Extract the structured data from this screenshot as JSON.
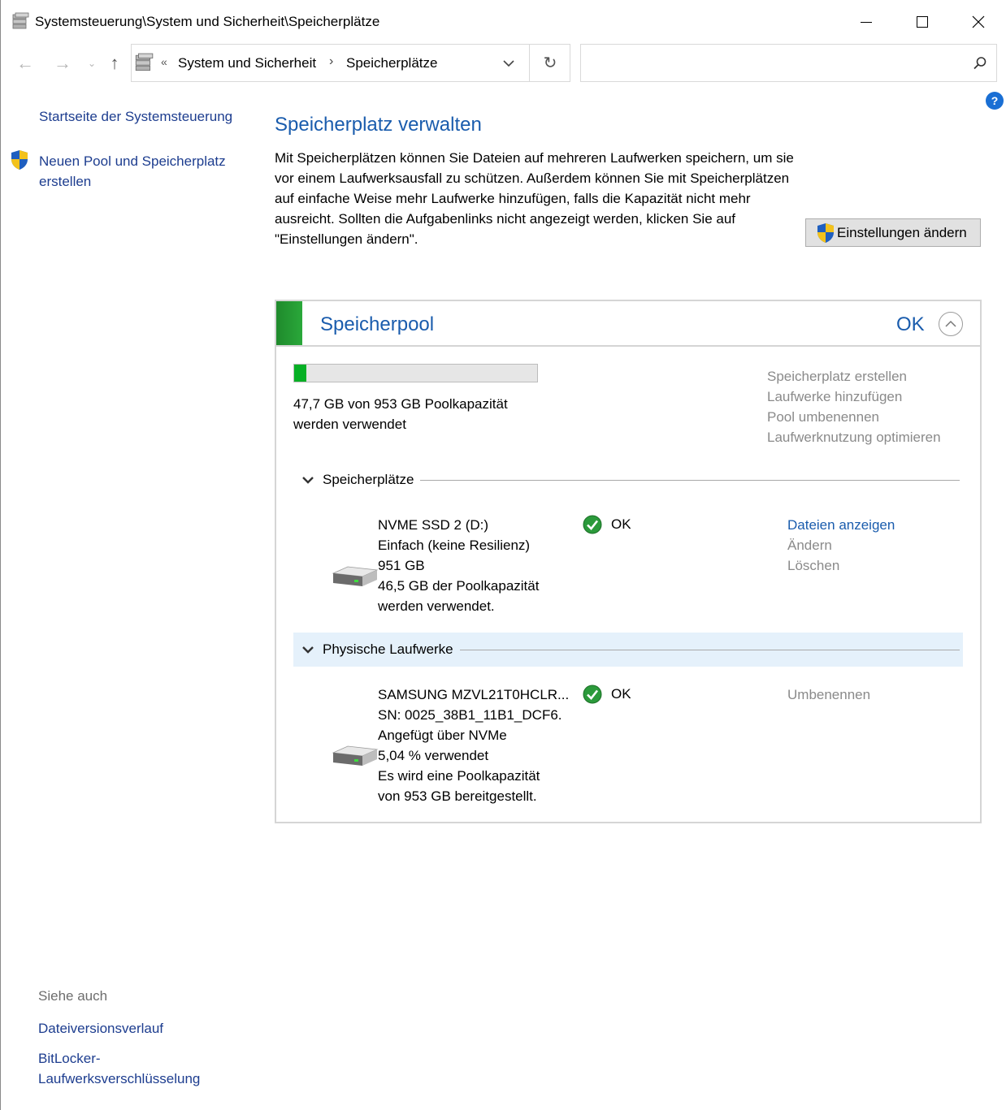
{
  "window": {
    "title": "Systemsteuerung\\System und Sicherheit\\Speicherplätze"
  },
  "navigation": {
    "back_glyph": "←",
    "forward_glyph": "→",
    "recent_glyph": "⌄",
    "up_glyph": "↑",
    "breadcrumb_overflow": "«",
    "breadcrumbs": [
      "System und Sicherheit",
      "Speicherplätze"
    ],
    "breadcrumb_separator": "›",
    "refresh_glyph": "↻",
    "search_placeholder": ""
  },
  "help": {
    "label": "?"
  },
  "left_pane": {
    "home_link": "Startseite der Systemsteuerung",
    "new_pool_link": "Neuen Pool und Speicherplatz erstellen",
    "see_also_label": "Siehe auch",
    "see_also_links": [
      "Dateiversionsverlauf",
      "BitLocker-Laufwerksverschlüsselung"
    ]
  },
  "main": {
    "title": "Speicherplatz verwalten",
    "intro": "Mit Speicherplätzen können Sie Dateien auf mehreren Laufwerken speichern, um sie vor einem Laufwerksausfall zu schützen. Außerdem können Sie mit Speicherplätzen auf einfache Weise mehr Laufwerke hinzufügen, falls die Kapazität nicht mehr ausreicht. Sollten die Aufgabenlinks nicht angezeigt werden, klicken Sie auf \"Einstellungen ändern\".",
    "settings_button": "Einstellungen ändern"
  },
  "pool": {
    "name": "Speicherpool",
    "status": "OK",
    "usage_fraction": 0.05,
    "usage_line1": "47,7 GB von 953 GB Poolkapazität",
    "usage_line2": "werden verwendet",
    "tasks": [
      "Speicherplatz erstellen",
      "Laufwerke hinzufügen",
      "Pool umbenennen",
      "Laufwerknutzung optimieren"
    ],
    "spaces_section": {
      "label": "Speicherplätze",
      "items": [
        {
          "lines": [
            "NVME SSD 2 (D:)",
            "Einfach (keine Resilienz)",
            "951 GB",
            "46,5 GB der Poolkapazität",
            "werden verwendet."
          ],
          "status": "OK",
          "actions": [
            "Dateien anzeigen",
            "Ändern",
            "Löschen"
          ]
        }
      ]
    },
    "drives_section": {
      "label": "Physische Laufwerke",
      "items": [
        {
          "lines": [
            "SAMSUNG MZVL21T0HCLR...",
            "SN: 0025_38B1_11B1_DCF6.",
            "Angefügt über NVMe",
            "5,04 % verwendet",
            "Es wird eine Poolkapazität",
            "von 953 GB bereitgestellt."
          ],
          "status": "OK",
          "actions": [
            "Umbenennen"
          ]
        }
      ]
    }
  },
  "colors": {
    "link_blue": "#1a5cad",
    "nav_link": "#1d3d8f",
    "disabled_gray": "#8a8a8a",
    "pool_green": "#2aa83a",
    "usage_green": "#06b025",
    "highlight_row": "#e5f1fb"
  }
}
